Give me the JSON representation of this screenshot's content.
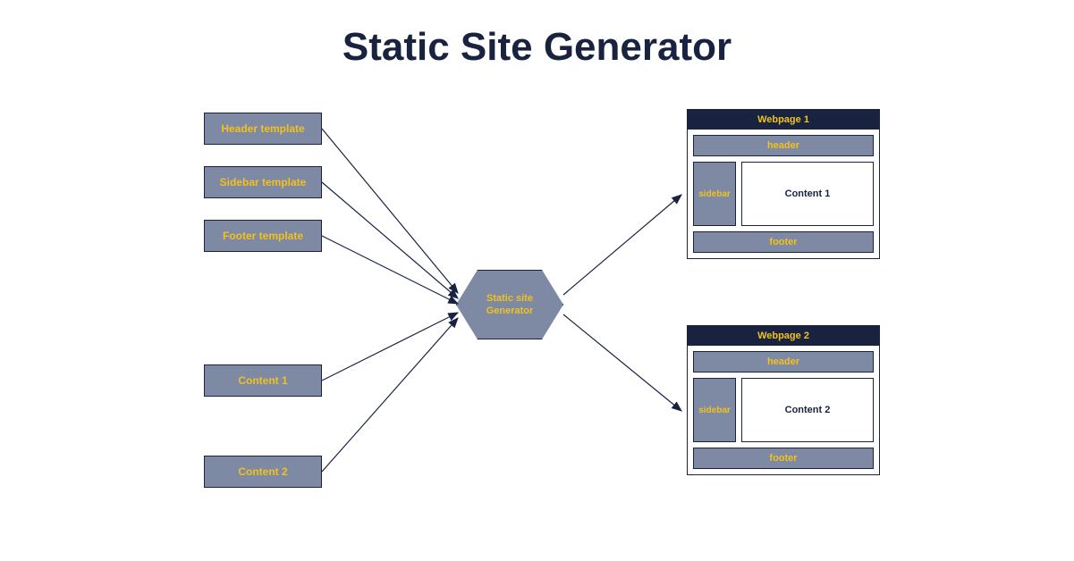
{
  "title": "Static Site Generator",
  "inputs": {
    "header_template": "Header template",
    "sidebar_template": "Sidebar template",
    "footer_template": "Footer template",
    "content_1": "Content 1",
    "content_2": "Content 2"
  },
  "generator": {
    "label": "Static site\nGenerator"
  },
  "webpages": [
    {
      "title": "Webpage 1",
      "header": "header",
      "sidebar": "sidebar",
      "content": "Content 1",
      "footer": "footer"
    },
    {
      "title": "Webpage 2",
      "header": "header",
      "sidebar": "sidebar",
      "content": "Content 2",
      "footer": "footer"
    }
  ],
  "colors": {
    "box_fill": "#7e89a3",
    "box_text": "#f2c11e",
    "dark": "#19233f"
  }
}
